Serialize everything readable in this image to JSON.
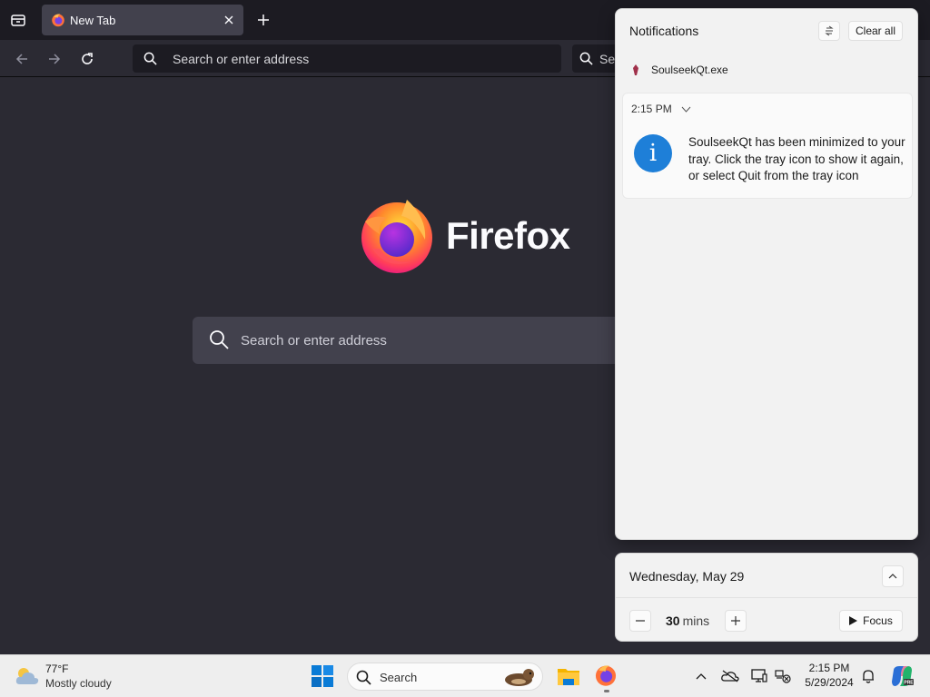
{
  "browser": {
    "tab": {
      "title": "New Tab"
    },
    "url_bar": {
      "placeholder": "Search or enter address"
    },
    "search_bar": {
      "placeholder": "Sea"
    },
    "newtab": {
      "brand": "Firefox",
      "search_placeholder": "Search or enter address"
    }
  },
  "notifications": {
    "title": "Notifications",
    "clear_all_label": "Clear all",
    "app_name": "SoulseekQt.exe",
    "toast": {
      "time": "2:15 PM",
      "message": "SoulseekQt has been minimized to your tray. Click the tray icon to show it again, or select Quit from the tray icon"
    }
  },
  "calendar": {
    "date": "Wednesday, May 29",
    "focus_minutes": "30",
    "focus_unit": "mins",
    "focus_label": "Focus"
  },
  "taskbar": {
    "weather": {
      "temp": "77°F",
      "condition": "Mostly cloudy"
    },
    "search_label": "Search",
    "clock": {
      "time": "2:15 PM",
      "date": "5/29/2024"
    }
  },
  "colors": {
    "firefox_bg": "#2b2a33",
    "firefox_toolbar": "#1c1b22",
    "info_blue": "#1e7fd8",
    "windows_blue": "#0a7bd6"
  },
  "icons": [
    "tab-list-icon",
    "firefox-icon",
    "close-icon",
    "plus-icon",
    "back-arrow-icon",
    "forward-arrow-icon",
    "reload-icon",
    "search-icon",
    "info-icon",
    "do-not-disturb-icon",
    "chevron-down-icon",
    "chevron-up-icon",
    "minus-icon",
    "play-icon",
    "weather-cloud-icon",
    "windows-start-icon",
    "file-explorer-icon",
    "chevron-up-tray-icon",
    "onedrive-icon",
    "display-icon",
    "network-icon",
    "bell-icon",
    "copilot-icon"
  ]
}
